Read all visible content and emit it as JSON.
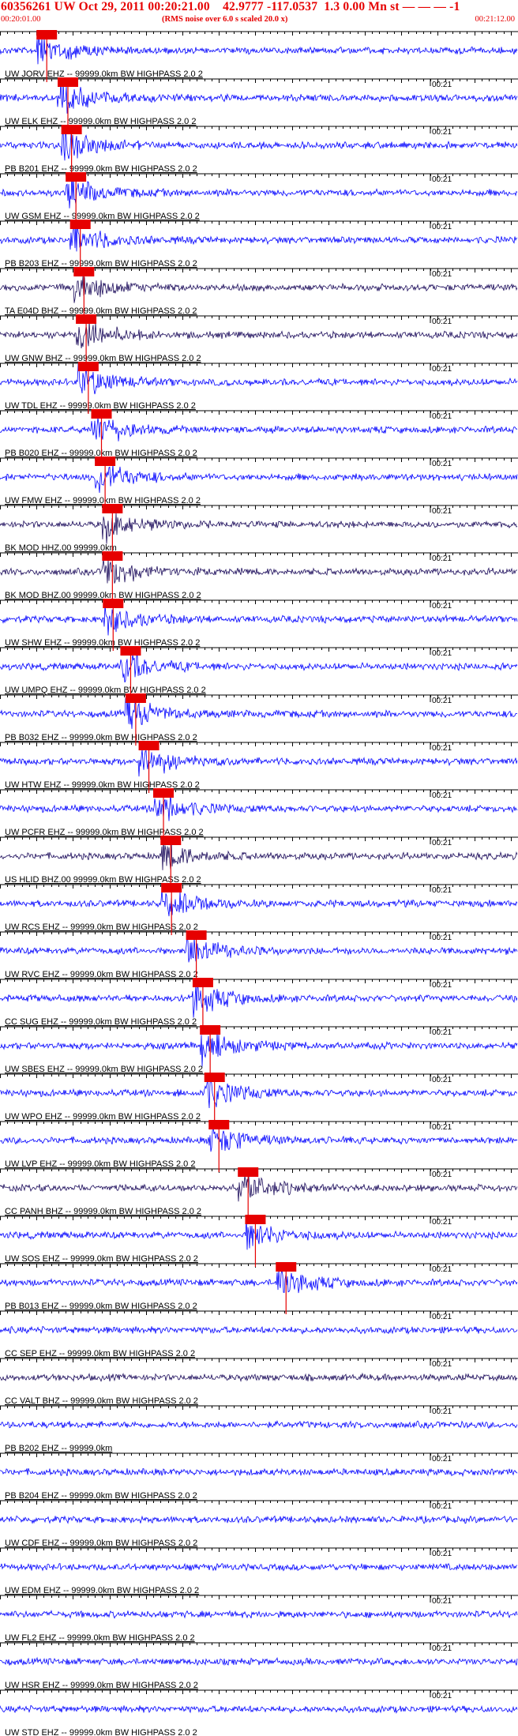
{
  "header": {
    "title": "60356261 UW Oct 29, 2011 00:20:21.00    42.9777 -117.0537  1.3 0.00 Mn st — — — -1",
    "time_start": "00:20:01.00",
    "rms_note": "(RMS noise over 6.0 s scaled 20.0 x)",
    "time_end": "00:21:12.00"
  },
  "chart_data": {
    "type": "seismogram",
    "time_window": [
      "00:20:01.00",
      "00:21:12.00"
    ],
    "time_marker_label": "00:21",
    "traces": [
      {
        "label": "UW JORV EHZ -- 99999.0km BW  HIGHPASS  2.0  2",
        "color": "#0000ff",
        "pick": 5.0
      },
      {
        "label": "UW ELK EHZ -- 99999.0km BW  HIGHPASS  2.0  2",
        "color": "#0000ff",
        "pick": 7.9
      },
      {
        "label": "PB B201 EHZ -- 99999.0km BW  HIGHPASS  2.0  2",
        "color": "#0000ff",
        "pick": 8.4
      },
      {
        "label": "UW GSM EHZ -- 99999.0km BW  HIGHPASS  2.0  2",
        "color": "#0000ff",
        "pick": 9.0
      },
      {
        "label": "PB B203 EHZ -- 99999.0km BW  HIGHPASS  2.0  2",
        "color": "#0000ff",
        "pick": 9.6
      },
      {
        "label": "TA E04D BHZ -- 99999.0km BW  HIGHPASS  2.0  2",
        "color": "#1a0a5a",
        "pick": 10.1
      },
      {
        "label": "UW GNW BHZ -- 99999.0km BW  HIGHPASS  2.0  2",
        "color": "#1a0a5a",
        "pick": 10.4
      },
      {
        "label": "UW TDL EHZ -- 99999.0km BW  HIGHPASS  2.0  2",
        "color": "#0000ff",
        "pick": 10.7
      },
      {
        "label": "PB B020 EHZ -- 99999.0km BW  HIGHPASS  2.0  2",
        "color": "#0000ff",
        "pick": 12.5
      },
      {
        "label": "UW FMW EHZ -- 99999.0km BW  HIGHPASS  2.0  2",
        "color": "#0000ff",
        "pick": 13.0
      },
      {
        "label": "BK MOD HHZ.00 99999.0km",
        "color": "#1a0a5a",
        "pick": 14.0
      },
      {
        "label": "BK MOD BHZ.00 99999.0km BW  HIGHPASS  2.0  2",
        "color": "#1a0a5a",
        "pick": 14.0
      },
      {
        "label": "UW SHW EHZ -- 99999.0km BW  HIGHPASS  2.0  2",
        "color": "#0000ff",
        "pick": 14.1
      },
      {
        "label": "UW UMPQ EHZ -- 99999.0km BW  HIGHPASS  2.0  2",
        "color": "#0000ff",
        "pick": 16.5
      },
      {
        "label": "PB B032 EHZ -- 99999.0km BW  HIGHPASS  2.0  2",
        "color": "#0000ff",
        "pick": 17.2
      },
      {
        "label": "UW HTW EHZ -- 99999.0km BW  HIGHPASS  2.0  2",
        "color": "#0000ff",
        "pick": 19.0
      },
      {
        "label": "UW PCFR EHZ -- 99999.0km BW  HIGHPASS  2.0  2",
        "color": "#0000ff",
        "pick": 21.0
      },
      {
        "label": "US HLID BHZ.00 99999.0km BW  HIGHPASS  2.0  2",
        "color": "#1a0a5a",
        "pick": 22.0
      },
      {
        "label": "UW RCS EHZ -- 99999.0km BW  HIGHPASS  2.0  2",
        "color": "#0000ff",
        "pick": 22.1
      },
      {
        "label": "UW RVC EHZ -- 99999.0km BW  HIGHPASS  2.0  2",
        "color": "#0000ff",
        "pick": 25.5
      },
      {
        "label": "CC SUG EHZ -- 99999.0km BW  HIGHPASS  2.0  2",
        "color": "#0000ff",
        "pick": 26.4
      },
      {
        "label": "UW SBES EHZ -- 99999.0km BW  HIGHPASS  2.0  2",
        "color": "#0000ff",
        "pick": 27.4
      },
      {
        "label": "UW WPO EHZ -- 99999.0km BW  HIGHPASS  2.0  2",
        "color": "#0000ff",
        "pick": 28.0
      },
      {
        "label": "UW LVP EHZ -- 99999.0km BW  HIGHPASS  2.0  2",
        "color": "#0000ff",
        "pick": 28.6
      },
      {
        "label": "CC PANH BHZ -- 99999.0km BW  HIGHPASS  2.0  2",
        "color": "#1a0a5a",
        "pick": 32.6
      },
      {
        "label": "UW SOS EHZ -- 99999.0km BW  HIGHPASS  2.0  2",
        "color": "#0000ff",
        "pick": 33.6
      },
      {
        "label": "PB B013 EHZ -- 99999.0km BW  HIGHPASS  2.0  2",
        "color": "#0000ff",
        "pick": 37.8
      },
      {
        "label": "CC SEP EHZ -- 99999.0km BW  HIGHPASS  2.0  2",
        "color": "#0000ff",
        "pick": null
      },
      {
        "label": "CC VALT BHZ -- 99999.0km BW  HIGHPASS  2.0  2",
        "color": "#1a0a5a",
        "pick": null
      },
      {
        "label": "PB B202 EHZ -- 99999.0km",
        "color": "#0000ff",
        "pick": null
      },
      {
        "label": "PB B204 EHZ -- 99999.0km BW  HIGHPASS  2.0  2",
        "color": "#0000ff",
        "pick": null
      },
      {
        "label": "UW CDF EHZ -- 99999.0km BW  HIGHPASS  2.0  2",
        "color": "#0000ff",
        "pick": null
      },
      {
        "label": "UW EDM EHZ -- 99999.0km BW  HIGHPASS  2.0  2",
        "color": "#0000ff",
        "pick": null
      },
      {
        "label": "UW FL2 EHZ -- 99999.0km BW  HIGHPASS  2.0  2",
        "color": "#0000ff",
        "pick": null
      },
      {
        "label": "UW HSR EHZ -- 99999.0km BW  HIGHPASS  2.0  2",
        "color": "#0000ff",
        "pick": null
      },
      {
        "label": "UW STD EHZ -- 99999.0km BW  HIGHPASS  2.0  2",
        "color": "#0000ff",
        "pick": null
      }
    ]
  }
}
